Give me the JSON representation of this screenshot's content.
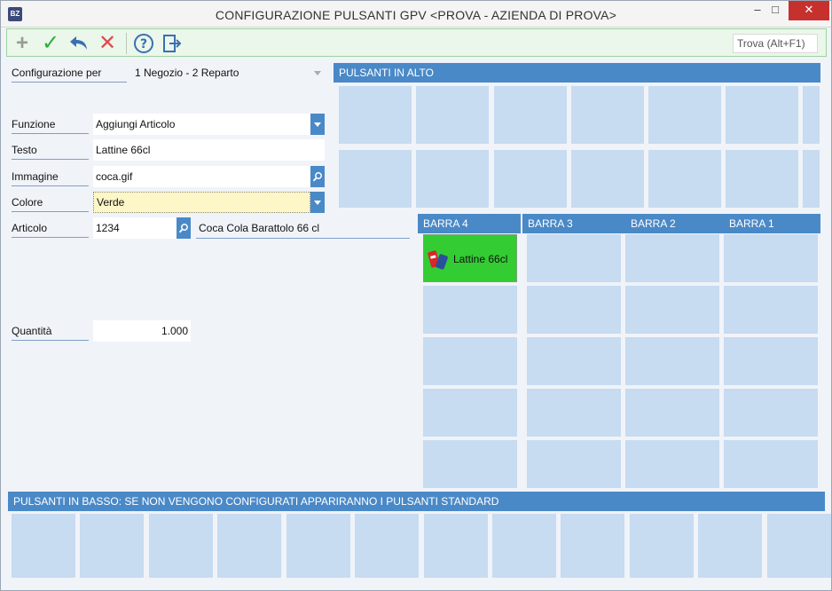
{
  "window": {
    "title": "CONFIGURAZIONE PULSANTI GPV <PROVA - AZIENDA DI PROVA>",
    "app_icon_text": "BZ",
    "minimize": "–",
    "maximize": "□",
    "close": "✕"
  },
  "toolbar": {
    "add_icon": "plus-icon",
    "ok_icon": "check-icon",
    "undo_icon": "undo-icon",
    "cancel_icon": "close-icon",
    "help_icon": "help-icon",
    "exit_icon": "exit-icon",
    "search_placeholder": "Trova (Alt+F1)"
  },
  "form": {
    "configurazione_label": "Configurazione per",
    "configurazione_value": "1 Negozio - 2 Reparto",
    "funzione_label": "Funzione",
    "funzione_value": "Aggiungi Articolo",
    "testo_label": "Testo",
    "testo_value": "Lattine 66cl",
    "immagine_label": "Immagine",
    "immagine_value": "coca.gif",
    "colore_label": "Colore",
    "colore_value": "Verde",
    "articolo_label": "Articolo",
    "articolo_code": "1234",
    "articolo_desc": "Coca Cola Barattolo 66 cl",
    "quantita_label": "Quantità",
    "quantita_value": "1.000"
  },
  "panels": {
    "top_header": "PULSANTI IN ALTO",
    "barra4": "BARRA 4",
    "barra3": "BARRA 3",
    "barra2": "BARRA 2",
    "barra1": "BARRA 1",
    "bottom_header": "PULSANTI IN BASSO: SE NON VENGONO CONFIGURATI APPARIRANNO I PULSANTI STANDARD"
  },
  "configured_button": {
    "label": "Lattine 66cl",
    "color": "#33cc33",
    "image_icon": "soda-can-icon"
  },
  "colors": {
    "accent": "#4a89c7",
    "slot": "#c7dbf1",
    "toolbar_bg": "#eaf7ea",
    "close_btn": "#c7312d"
  }
}
